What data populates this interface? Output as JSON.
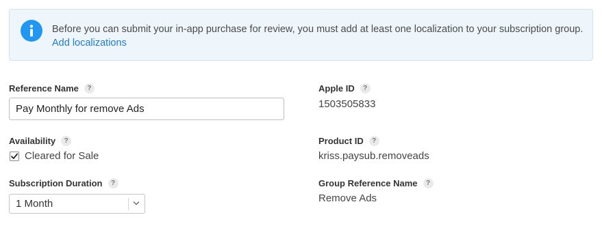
{
  "banner": {
    "icon": "info-icon",
    "message": "Before you can submit your in-app purchase for review, you must add at least one localization to your subscription group.",
    "link_label": "Add localizations",
    "accent_color": "#2196f3"
  },
  "form": {
    "reference_name": {
      "label": "Reference Name",
      "value": "Pay Monthly for remove Ads"
    },
    "availability": {
      "label": "Availability",
      "checkbox_label": "Cleared for Sale",
      "checked": true
    },
    "subscription_duration": {
      "label": "Subscription Duration",
      "selected": "1 Month"
    },
    "apple_id": {
      "label": "Apple ID",
      "value": "1503505833"
    },
    "product_id": {
      "label": "Product ID",
      "value": "kriss.paysub.removeads"
    },
    "group_reference_name": {
      "label": "Group Reference Name",
      "value": "Remove Ads"
    }
  },
  "help_glyph": "?",
  "link_color": "#1c7bd6"
}
